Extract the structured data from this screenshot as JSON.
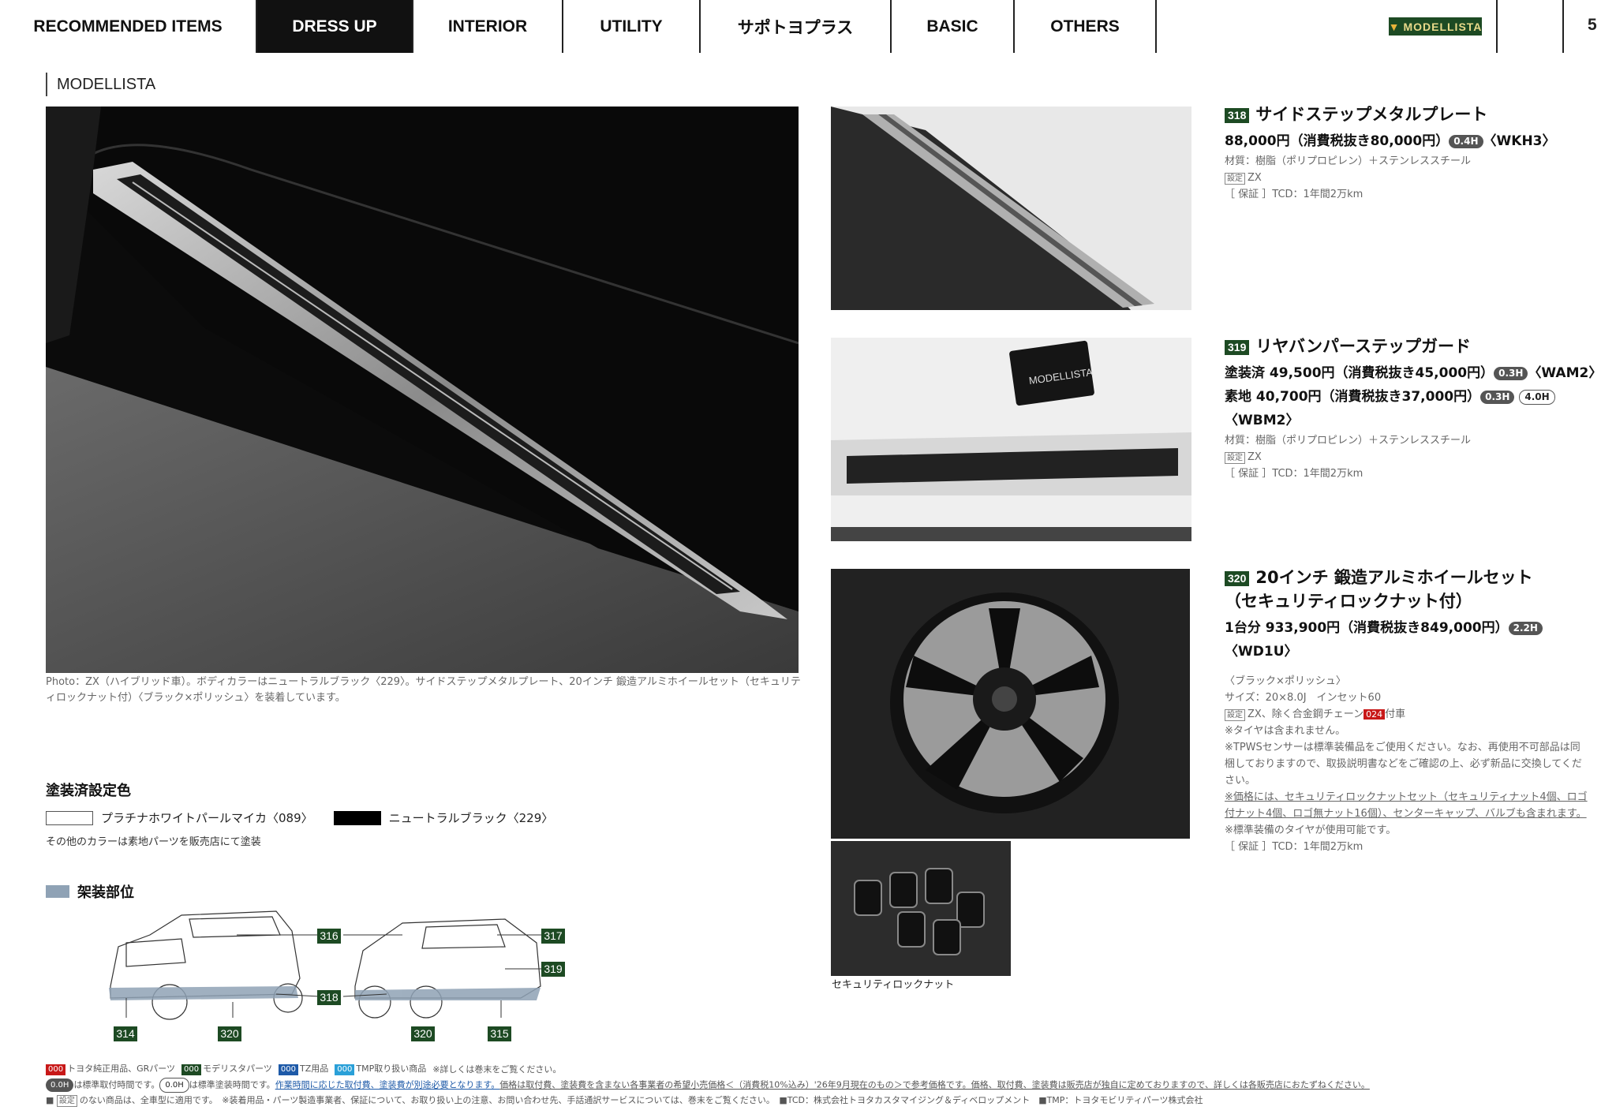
{
  "nav": {
    "tabs": [
      {
        "label": "RECOMMENDED ITEMS",
        "active": false
      },
      {
        "label": "DRESS UP",
        "active": true
      },
      {
        "label": "INTERIOR",
        "active": false
      },
      {
        "label": "UTILITY",
        "active": false
      },
      {
        "label": "サポトヨプラス",
        "active": false
      },
      {
        "label": "BASIC",
        "active": false
      },
      {
        "label": "OTHERS",
        "active": false
      }
    ],
    "brand_logo": "MODELLISTA",
    "page_number": "5"
  },
  "section_title": "MODELLISTA",
  "main_photo_caption": "Photo：ZX（ハイブリッド車）。ボディカラーはニュートラルブラック〈229〉。サイドステップメタルプレート、20インチ 鍛造アルミホイールセット（セキュリティロックナット付）〈ブラック×ポリッシュ〉を装着しています。",
  "products": [
    {
      "code": "318",
      "title": "サイドステップメタルプレート",
      "price_lines": [
        {
          "text": "88,000円（消費税抜き80,000円）",
          "hours": [
            "0.4H"
          ],
          "part": "〈WKH3〉"
        }
      ],
      "material": "材質：樹脂（ポリプロピレン）＋ステンレススチール",
      "setting_tag": "設定",
      "setting": "ZX",
      "warranty": "［ 保証 ］TCD：1年間2万km"
    },
    {
      "code": "319",
      "title": "リヤバンパーステップガード",
      "price_lines": [
        {
          "text": "塗装済 49,500円（消費税抜き45,000円）",
          "hours": [
            "0.3H"
          ],
          "part": "〈WAM2〉"
        },
        {
          "text": "素地 40,700円（消費税抜き37,000円）",
          "hours": [
            "0.3H",
            "4.0H"
          ],
          "part": "〈WBM2〉"
        }
      ],
      "material": "材質：樹脂（ポリプロピレン）＋ステンレススチール",
      "setting_tag": "設定",
      "setting": "ZX",
      "warranty": "［ 保証 ］TCD：1年間2万km"
    },
    {
      "code": "320",
      "title": "20インチ 鍛造アルミホイールセット",
      "title2": "（セキュリティロックナット付）",
      "price_lines": [
        {
          "text": "1台分 933,900円（消費税抜き849,000円）",
          "hours": [
            "2.2H"
          ],
          "part": "〈WD1U〉"
        }
      ],
      "color": "〈ブラック×ポリッシュ〉",
      "size": "サイズ：20×8.0J　インセット60",
      "setting_tag": "設定",
      "setting": "ZX、除く合金鋼チェーン",
      "setting_code": "024",
      "setting_suffix": "付車",
      "notes": [
        "※タイヤは含まれません。",
        "※TPWSセンサーは標準装備品をご使用ください。なお、再使用不可部品は同梱しておりますので、取扱説明書などをご確認の上、必ず新品に交換してください。",
        "※価格には、セキュリティロックナットセット（セキュリティナット4個、ロゴ付ナット4個、ロゴ無ナット16個）、センターキャップ、バルブも含まれます。",
        "※標準装備のタイヤが使用可能です。"
      ],
      "warranty": "［ 保証 ］TCD：1年間2万km",
      "nut_caption": "セキュリティロックナット"
    }
  ],
  "paint": {
    "heading": "塗装済設定色",
    "colors": [
      {
        "name": "プラチナホワイトパールマイカ〈089〉",
        "swatch": "#ffffff"
      },
      {
        "name": "ニュートラルブラック〈229〉",
        "swatch": "#000000"
      }
    ],
    "note": "その他のカラーは素地パーツを販売店にて塗装"
  },
  "mounting": {
    "heading": "架装部位",
    "markers": [
      "316",
      "317",
      "319",
      "318",
      "314",
      "320",
      "320",
      "315"
    ]
  },
  "footer": {
    "legend": [
      {
        "code": "000",
        "label": "トヨタ純正用品、GRパーツ",
        "color": "#c81818"
      },
      {
        "code": "000",
        "label": "モデリスタパーツ",
        "color": "#1d4a23"
      },
      {
        "code": "000",
        "label": "TZ用品",
        "color": "#1e5aa8"
      },
      {
        "code": "000",
        "label": "TMP取り扱い商品",
        "color": "#2aa0d8"
      }
    ],
    "legend_note": "※詳しくは巻末をご覧ください。",
    "line2_pill": "0.0H",
    "line2_a": "は標準取付時間です。",
    "line2_pill2": "0.0H",
    "line2_b": "は標準塗装時間です。",
    "line2_c": "作業時間に応じた取付費、塗装費が別途必要となります。",
    "line2_d": "価格は取付費、塗装費を含まない各事業者の希望小売価格＜（消費税10%込み）'26年9月現在のもの＞で参考価格です。価格、取付費、塗装費は販売店が独自に定めておりますので、詳しくは各販売店におたずねください。",
    "line3_tag": "設定",
    "line3": "のない商品は、全車型に適用です。　※装着用品・パーツ製造事業者、保証について、お取り扱い上の注意、お問い合わせ先、手話通訳サービスについては、巻末をご覧ください。　■TCD：株式会社トヨタカスタマイジング＆ディベロップメント　■TMP：トヨタモビリティパーツ株式会社"
  }
}
